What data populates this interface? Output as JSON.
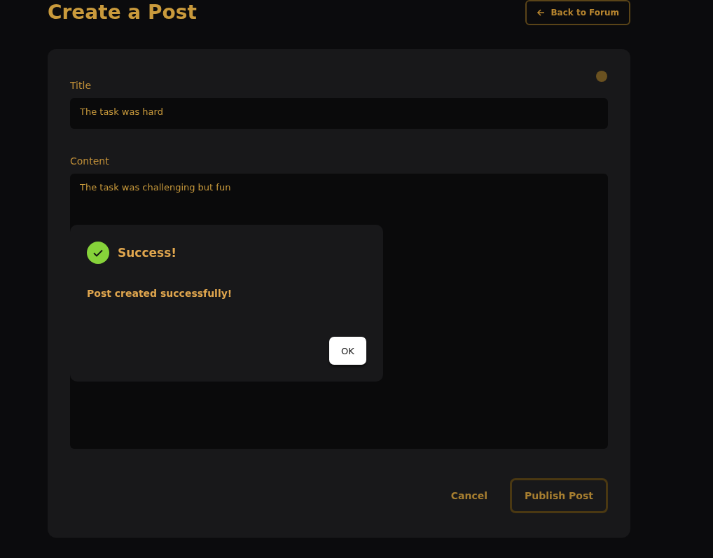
{
  "page": {
    "heading": "Create a Post",
    "back_button": "Back to Forum"
  },
  "form": {
    "fields": [
      {
        "kind": "input",
        "label": "Title",
        "value": "The task was hard"
      },
      {
        "kind": "textarea",
        "label": "Content",
        "value": "The task was challenging but fun"
      }
    ],
    "buttons": [
      {
        "kind": "text",
        "label": "Cancel"
      },
      {
        "kind": "outlined",
        "label": "Publish Post"
      }
    ]
  },
  "dialog": {
    "title": "Success!",
    "message": "Post created successfully!",
    "button": "OK"
  }
}
